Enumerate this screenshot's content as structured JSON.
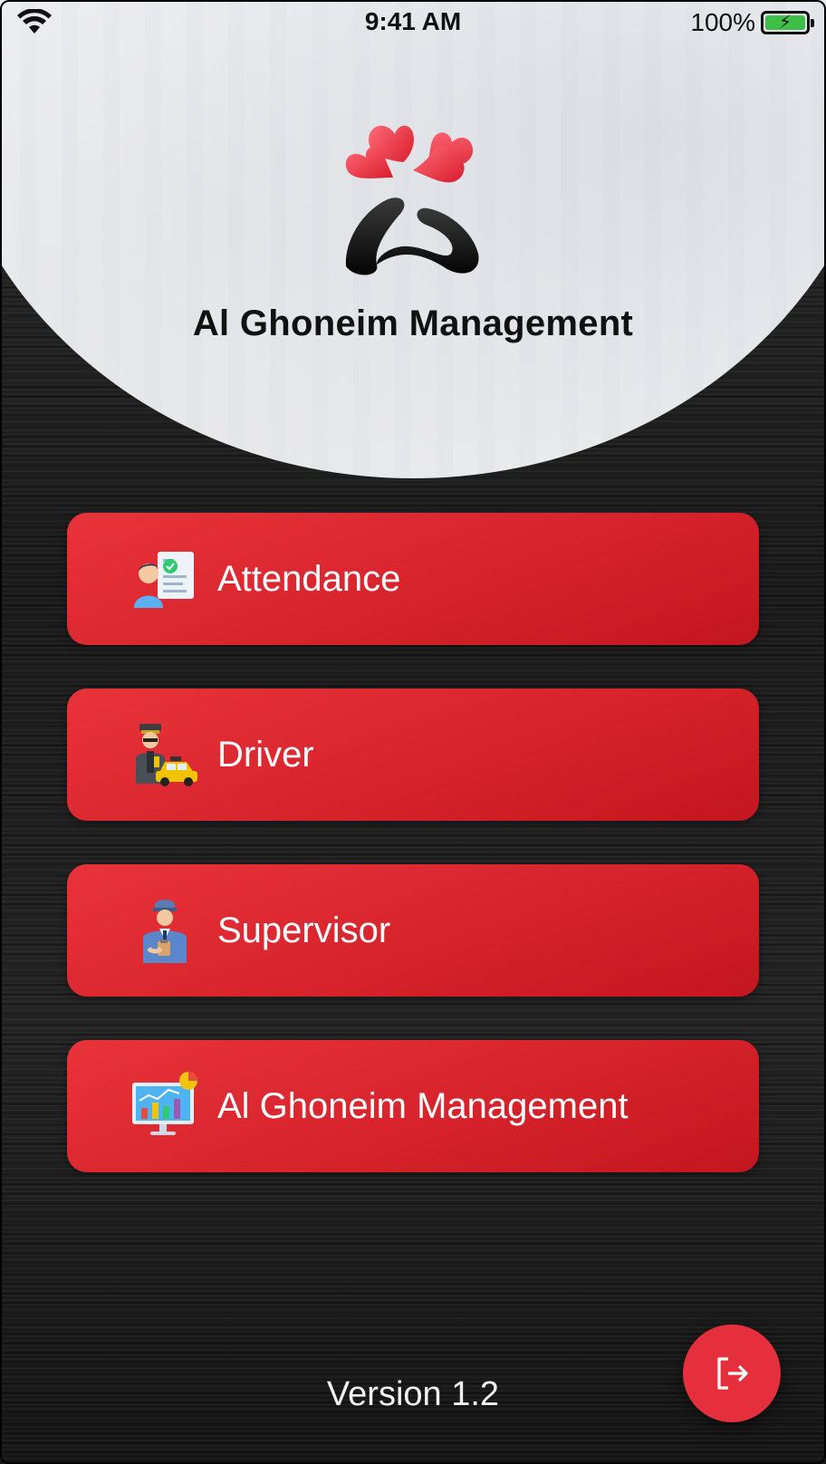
{
  "status_bar": {
    "time": "9:41 AM",
    "battery_percent": "100%",
    "wifi_icon": "wifi-icon",
    "battery_icon": "battery-charging-icon"
  },
  "header": {
    "logo_icon": "clover-logo-icon",
    "title": "Al Ghoneim Management"
  },
  "menu": {
    "items": [
      {
        "label": "Attendance",
        "icon": "attendance-icon"
      },
      {
        "label": "Driver",
        "icon": "driver-taxi-icon"
      },
      {
        "label": "Supervisor",
        "icon": "supervisor-icon"
      },
      {
        "label": "Al Ghoneim Management",
        "icon": "analytics-monitor-icon"
      }
    ]
  },
  "footer": {
    "version": "Version 1.2",
    "logout_icon": "logout-icon"
  },
  "colors": {
    "accent": "#e52f3c",
    "button": "#d7232c",
    "background": "#1b1b1b"
  }
}
